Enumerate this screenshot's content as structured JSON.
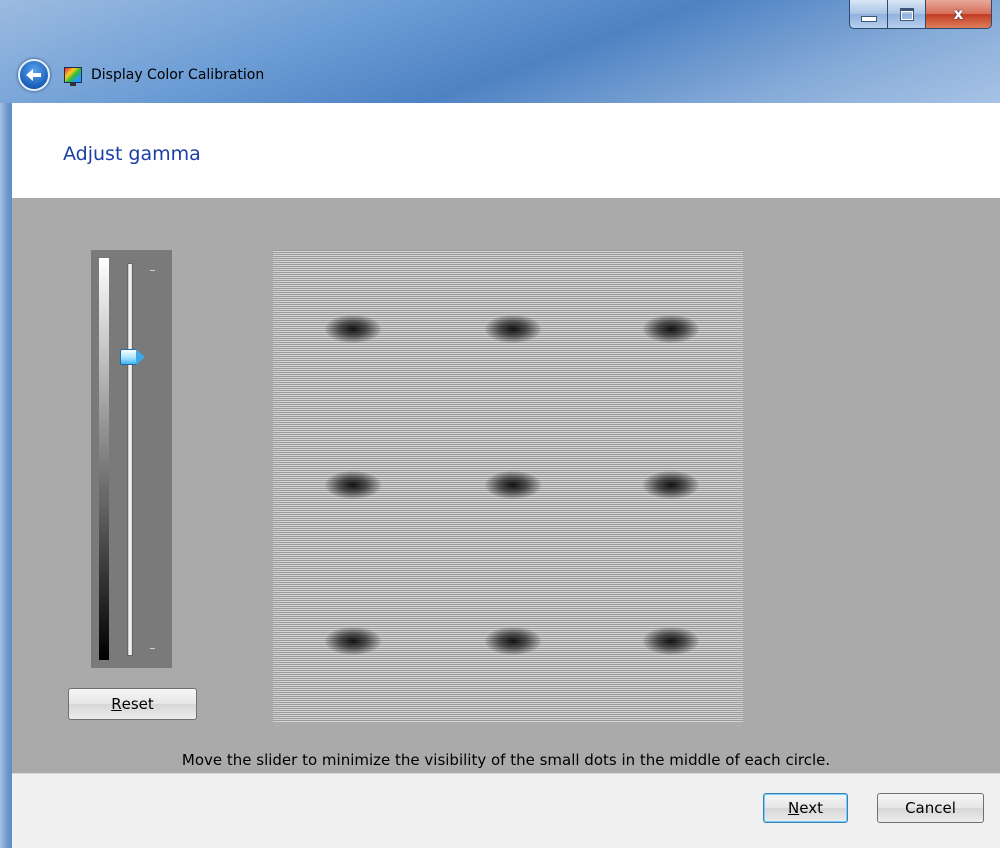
{
  "window": {
    "title": "Display Color Calibration",
    "caption_buttons": {
      "minimize": "",
      "maximize": "",
      "close": "x"
    },
    "accent_color": "#1c3ea6"
  },
  "nav": {
    "back_icon": "back-arrow-icon",
    "app_icon": "display-color-icon"
  },
  "page": {
    "title": "Adjust gamma",
    "instructions": "Move the slider to minimize the visibility of the small dots in the middle of each circle."
  },
  "gamma_slider": {
    "level_fraction": 0.24,
    "reset_label": "Reset",
    "reset_accel": "R",
    "reset_rest": "eset"
  },
  "test_pattern": {
    "rows": 3,
    "columns": 3
  },
  "footer": {
    "next_accel": "N",
    "next_rest": "ext",
    "cancel_label": "Cancel"
  }
}
